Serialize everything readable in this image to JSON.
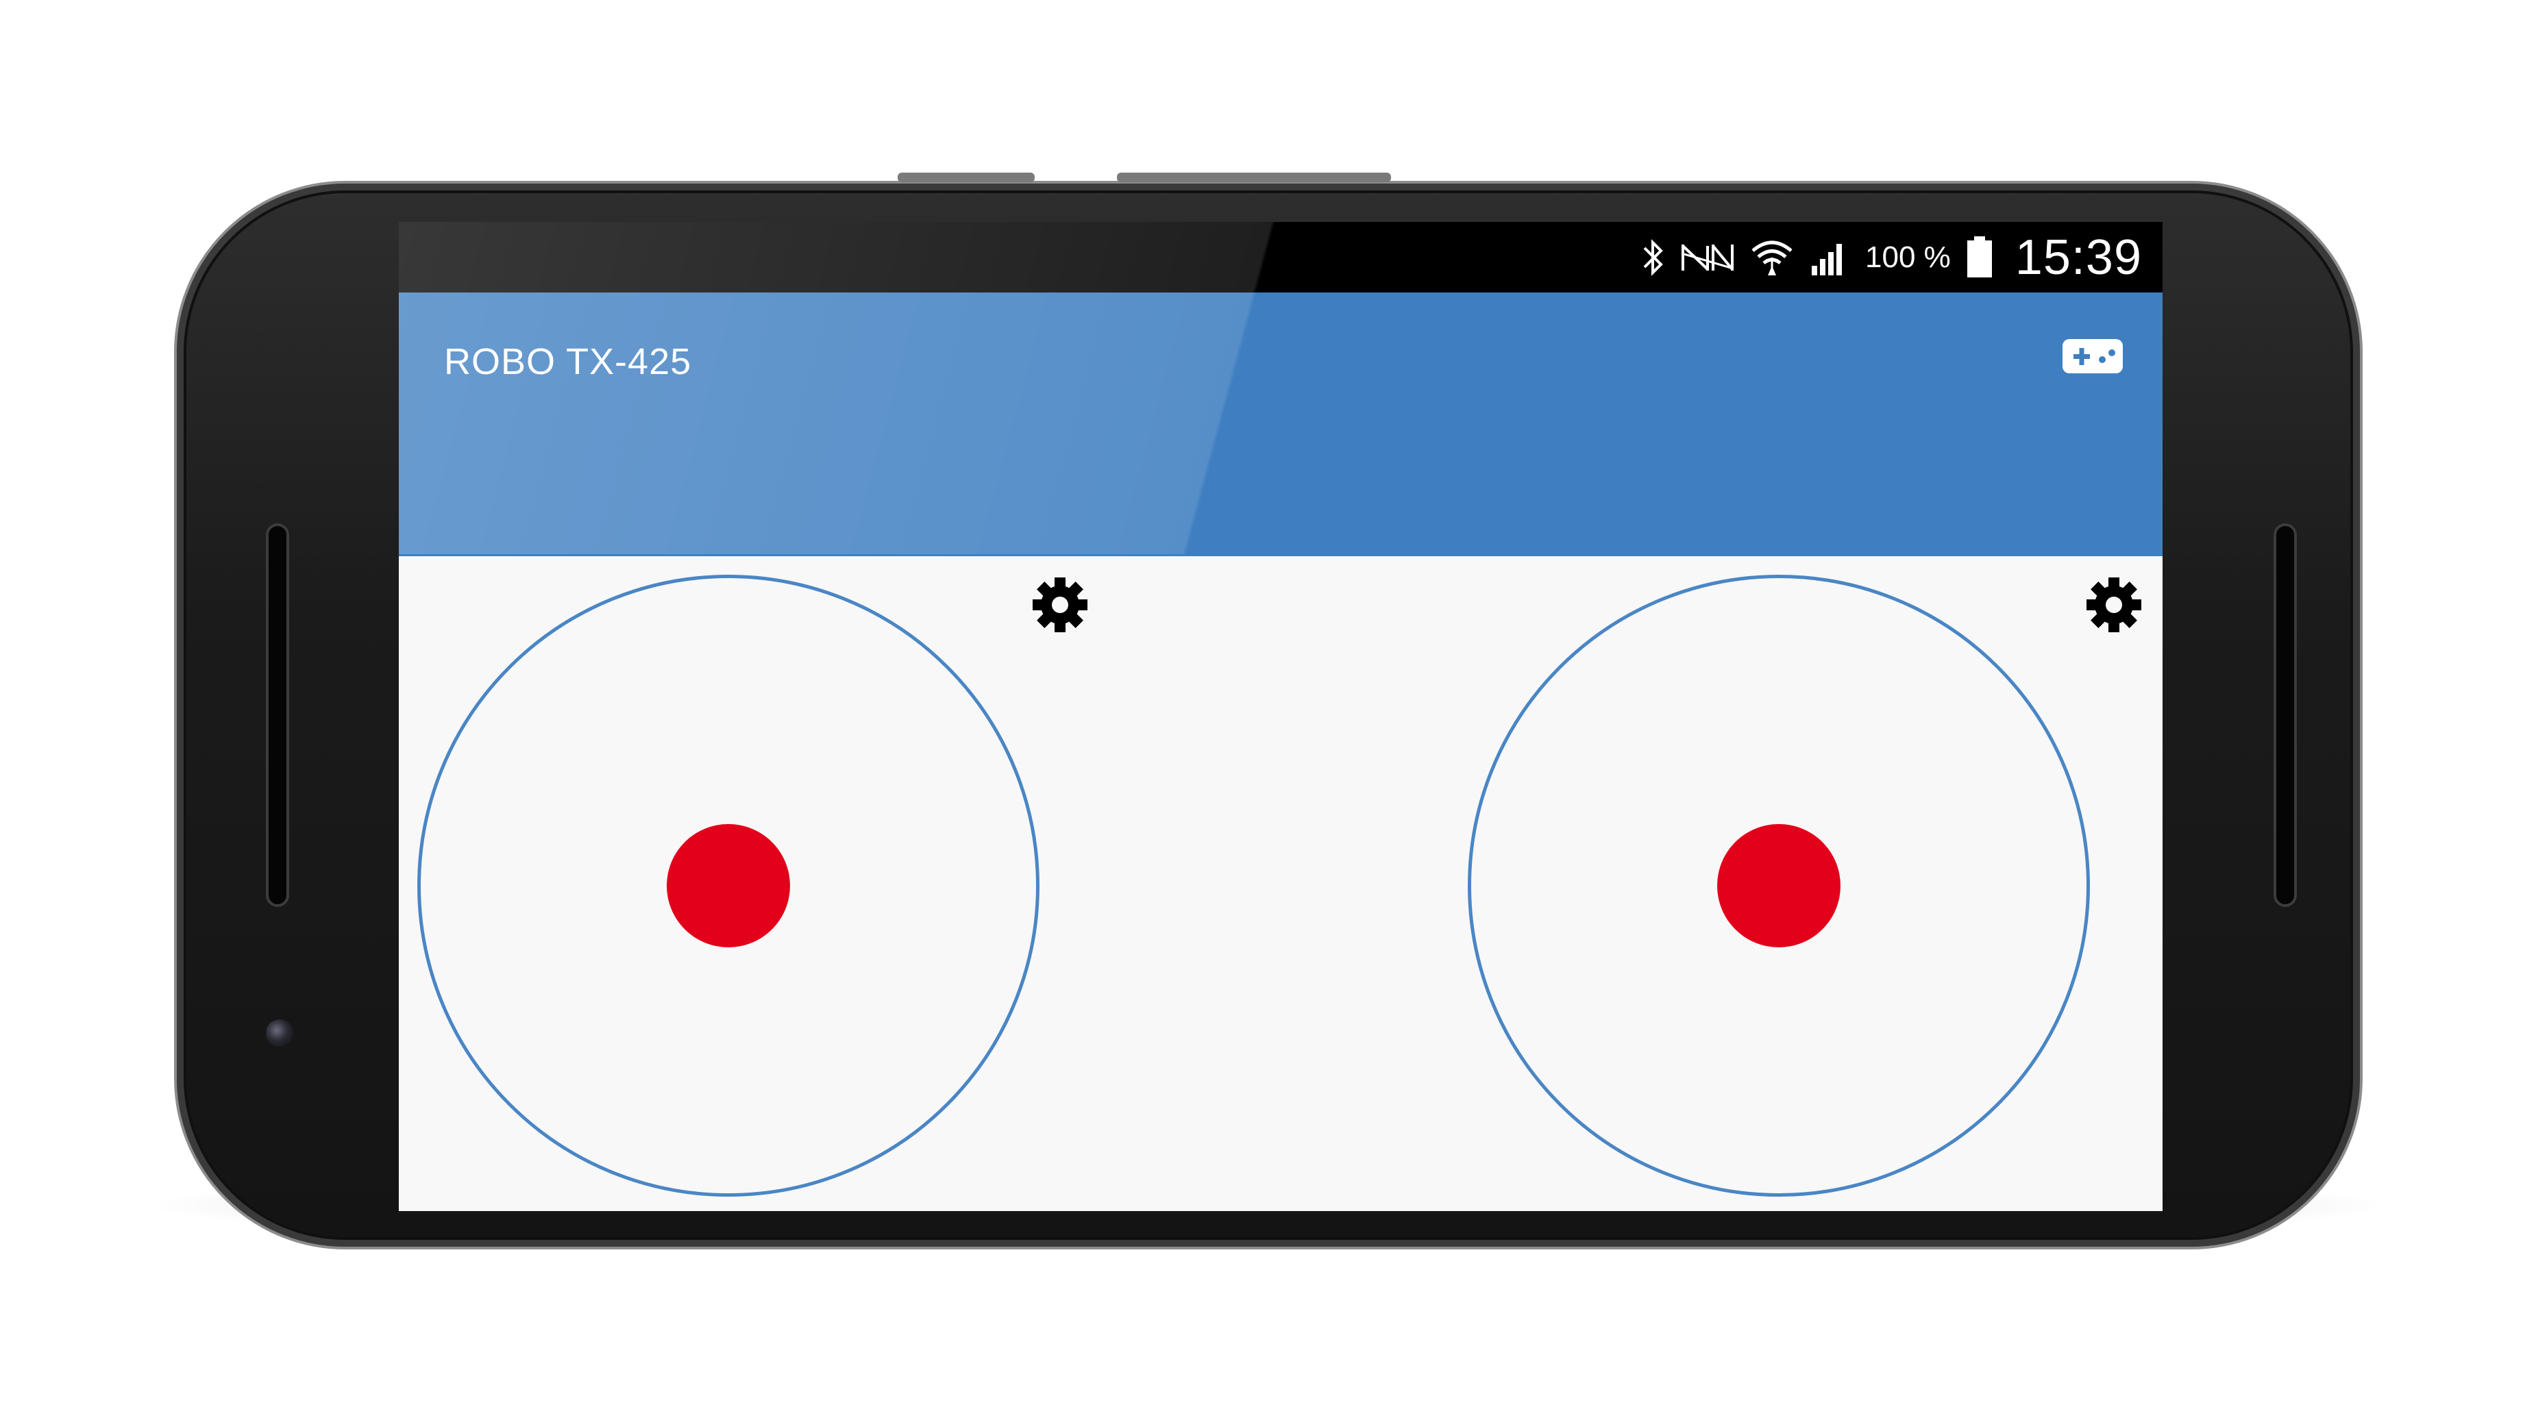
{
  "app": {
    "title": "ROBO TX-425"
  },
  "status_bar": {
    "icons": [
      "bluetooth-icon",
      "nfc-icon",
      "wifi-icon",
      "signal-icon",
      "battery-icon"
    ],
    "battery_percent": "100 %",
    "time": "15:39"
  },
  "toolbar": {
    "action_icon": "gamepad-icon"
  },
  "joysticks": [
    {
      "name": "left",
      "settings_icon": "gear-icon",
      "knob_offset": [
        0,
        0
      ]
    },
    {
      "name": "right",
      "settings_icon": "gear-icon",
      "knob_offset": [
        0,
        0
      ]
    }
  ],
  "colors": {
    "app_bar": "#3f7fc1",
    "ring": "#4a86c5",
    "knob": "#e3001b",
    "screen_bg": "#f8f8f8",
    "status_bar": "#000000"
  }
}
